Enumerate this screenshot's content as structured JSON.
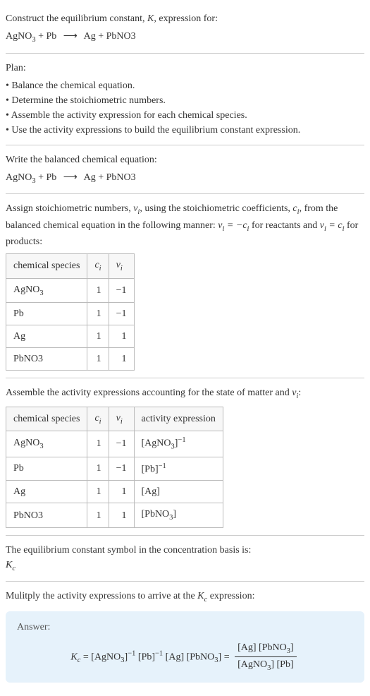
{
  "intro": {
    "line1_prefix": "Construct the equilibrium constant, ",
    "line1_K": "K",
    "line1_suffix": ", expression for:",
    "eq_lhs": "AgNO",
    "eq_lhs_sub": "3",
    "eq_lhs2": " + Pb ",
    "eq_arrow": "⟶",
    "eq_rhs": " Ag + PbNO3"
  },
  "plan": {
    "label": "Plan:",
    "items": [
      "• Balance the chemical equation.",
      "• Determine the stoichiometric numbers.",
      "• Assemble the activity expression for each chemical species.",
      "• Use the activity expressions to build the equilibrium constant expression."
    ]
  },
  "balanced": {
    "label": "Write the balanced chemical equation:",
    "eq_lhs": "AgNO",
    "eq_lhs_sub": "3",
    "eq_lhs2": " + Pb ",
    "eq_arrow": "⟶",
    "eq_rhs": " Ag + PbNO3"
  },
  "assign": {
    "text1": "Assign stoichiometric numbers, ",
    "nu": "ν",
    "sub_i": "i",
    "text2": ", using the stoichiometric coefficients, ",
    "c": "c",
    "text3": ", from the balanced chemical equation in the following manner: ",
    "eq_react": "ν",
    "eq_react2": " = −c",
    "text4": " for reactants and ",
    "eq_prod": "ν",
    "eq_prod2": " = c",
    "text5": " for products:"
  },
  "table1": {
    "headers": [
      "chemical species",
      "c",
      "ν"
    ],
    "header_sub": "i",
    "rows": [
      {
        "species_pre": "AgNO",
        "species_sub": "3",
        "species_post": "",
        "c": "1",
        "nu": "−1"
      },
      {
        "species_pre": "Pb",
        "species_sub": "",
        "species_post": "",
        "c": "1",
        "nu": "−1"
      },
      {
        "species_pre": "Ag",
        "species_sub": "",
        "species_post": "",
        "c": "1",
        "nu": "1"
      },
      {
        "species_pre": "PbNO3",
        "species_sub": "",
        "species_post": "",
        "c": "1",
        "nu": "1"
      }
    ]
  },
  "assemble": {
    "text1": "Assemble the activity expressions accounting for the state of matter and ",
    "nu": "ν",
    "sub_i": "i",
    "text2": ":"
  },
  "table2": {
    "headers": [
      "chemical species",
      "c",
      "ν",
      "activity expression"
    ],
    "header_sub": "i",
    "rows": [
      {
        "species_pre": "AgNO",
        "species_sub": "3",
        "c": "1",
        "nu": "−1",
        "act_pre": "[AgNO",
        "act_sub": "3",
        "act_mid": "]",
        "act_sup": "−1",
        "act_post": ""
      },
      {
        "species_pre": "Pb",
        "species_sub": "",
        "c": "1",
        "nu": "−1",
        "act_pre": "[Pb]",
        "act_sub": "",
        "act_mid": "",
        "act_sup": "−1",
        "act_post": ""
      },
      {
        "species_pre": "Ag",
        "species_sub": "",
        "c": "1",
        "nu": "1",
        "act_pre": "[Ag]",
        "act_sub": "",
        "act_mid": "",
        "act_sup": "",
        "act_post": ""
      },
      {
        "species_pre": "PbNO3",
        "species_sub": "",
        "c": "1",
        "nu": "1",
        "act_pre": "[PbNO",
        "act_sub": "3",
        "act_mid": "]",
        "act_sup": "",
        "act_post": ""
      }
    ]
  },
  "symbol": {
    "text": "The equilibrium constant symbol in the concentration basis is:",
    "K": "K",
    "sub_c": "c"
  },
  "multiply": {
    "text1": "Mulitply the activity expressions to arrive at the ",
    "K": "K",
    "sub_c": "c",
    "text2": " expression:"
  },
  "answer": {
    "label": "Answer:",
    "Kc_K": "K",
    "Kc_c": "c",
    "eq": " = ",
    "term1_pre": "[AgNO",
    "term1_sub": "3",
    "term1_mid": "]",
    "term1_sup": "−1",
    "term2_pre": " [Pb]",
    "term2_sup": "−1",
    "term3": " [Ag] [PbNO",
    "term3_sub": "3",
    "term3_post": "] = ",
    "frac_num_pre": "[Ag] [PbNO",
    "frac_num_sub": "3",
    "frac_num_post": "]",
    "frac_den_pre": "[AgNO",
    "frac_den_sub": "3",
    "frac_den_post": "] [Pb]"
  }
}
